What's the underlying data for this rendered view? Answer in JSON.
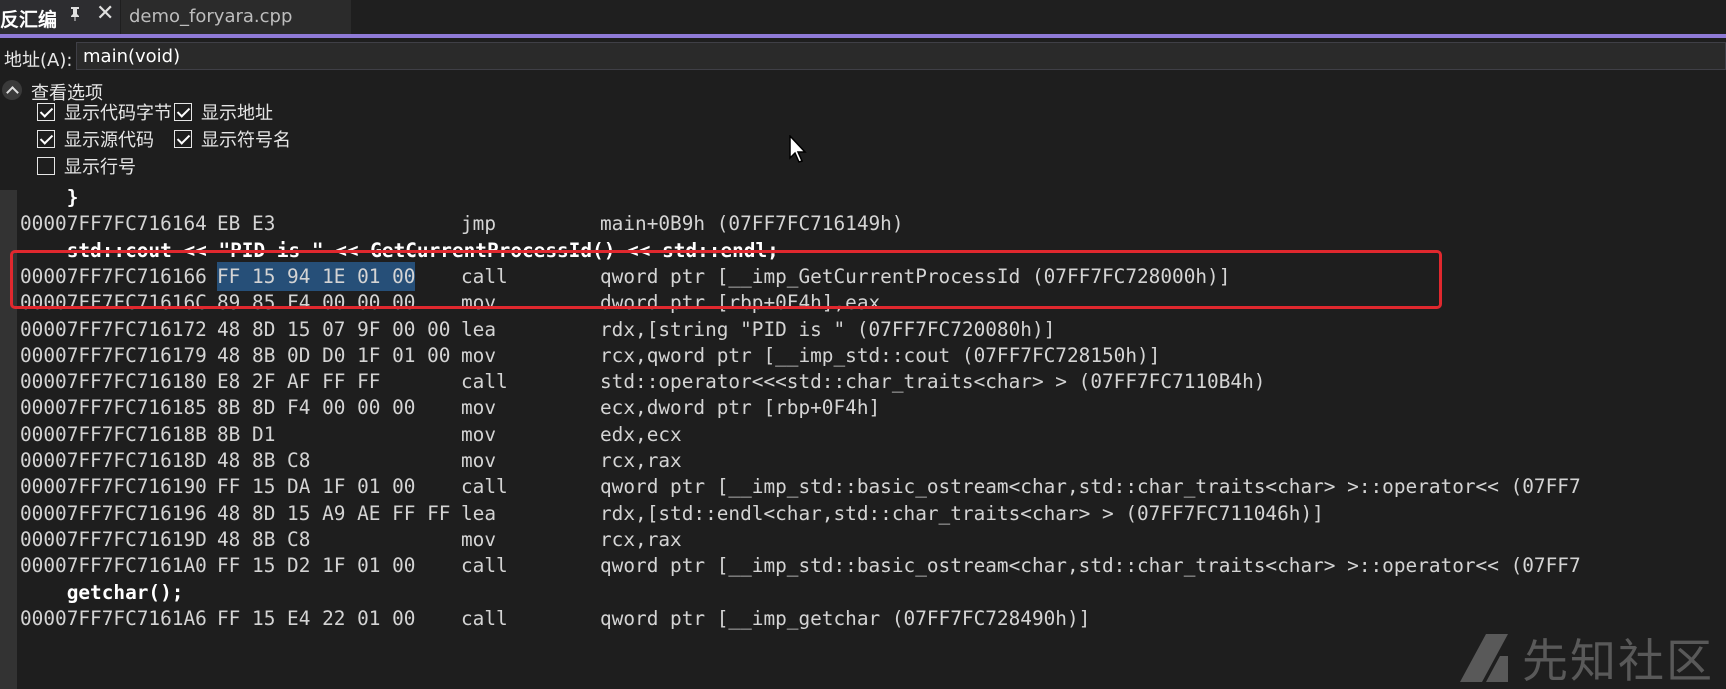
{
  "tabs": {
    "active_title": "反汇编",
    "pin_glyph": "ᵖ",
    "close_glyph": "✕",
    "inactive_title": "demo_foryara.cpp"
  },
  "address": {
    "label": "地址(A):",
    "value": "main(void)"
  },
  "options": {
    "title": "查看选项",
    "checkboxes": [
      {
        "label": "显示代码字节",
        "checked": true
      },
      {
        "label": "显示地址",
        "checked": true
      },
      {
        "label": "显示源代码",
        "checked": true
      },
      {
        "label": "显示符号名",
        "checked": true
      },
      {
        "label": "显示行号",
        "checked": false
      }
    ]
  },
  "code": {
    "lines": [
      {
        "type": "source",
        "text": "    }"
      },
      {
        "type": "asm",
        "addr": "00007FF7FC716164",
        "bytes": "EB E3",
        "op": "jmp",
        "args": "main+0B9h (07FF7FC716149h)"
      },
      {
        "type": "source",
        "text": "    std::cout << \"PID is \" << GetCurrentProcessId() << std::endl;"
      },
      {
        "type": "asm",
        "addr": "00007FF7FC716166",
        "bytes": "FF 15 94 1E 01 00",
        "op": "call",
        "args": "qword ptr [__imp_GetCurrentProcessId (07FF7FC728000h)]",
        "selected_bytes": true
      },
      {
        "type": "asm",
        "addr": "00007FF7FC71616C",
        "bytes": "89 85 F4 00 00 00",
        "op": "mov",
        "args": "dword ptr [rbp+0F4h],eax"
      },
      {
        "type": "asm",
        "addr": "00007FF7FC716172",
        "bytes": "48 8D 15 07 9F 00 00",
        "op": "lea",
        "args": "rdx,[string \"PID is \" (07FF7FC720080h)]"
      },
      {
        "type": "asm",
        "addr": "00007FF7FC716179",
        "bytes": "48 8B 0D D0 1F 01 00",
        "op": "mov",
        "args": "rcx,qword ptr [__imp_std::cout (07FF7FC728150h)]"
      },
      {
        "type": "asm",
        "addr": "00007FF7FC716180",
        "bytes": "E8 2F AF FF FF",
        "op": "call",
        "args": "std::operator<<<std::char_traits<char> > (07FF7FC7110B4h)"
      },
      {
        "type": "asm",
        "addr": "00007FF7FC716185",
        "bytes": "8B 8D F4 00 00 00",
        "op": "mov",
        "args": "ecx,dword ptr [rbp+0F4h]"
      },
      {
        "type": "asm",
        "addr": "00007FF7FC71618B",
        "bytes": "8B D1",
        "op": "mov",
        "args": "edx,ecx"
      },
      {
        "type": "asm",
        "addr": "00007FF7FC71618D",
        "bytes": "48 8B C8",
        "op": "mov",
        "args": "rcx,rax"
      },
      {
        "type": "asm",
        "addr": "00007FF7FC716190",
        "bytes": "FF 15 DA 1F 01 00",
        "op": "call",
        "args": "qword ptr [__imp_std::basic_ostream<char,std::char_traits<char> >::operator<< (07FF7"
      },
      {
        "type": "asm",
        "addr": "00007FF7FC716196",
        "bytes": "48 8D 15 A9 AE FF FF",
        "op": "lea",
        "args": "rdx,[std::endl<char,std::char_traits<char> > (07FF7FC711046h)]"
      },
      {
        "type": "asm",
        "addr": "00007FF7FC71619D",
        "bytes": "48 8B C8",
        "op": "mov",
        "args": "rcx,rax"
      },
      {
        "type": "asm",
        "addr": "00007FF7FC7161A0",
        "bytes": "FF 15 D2 1F 01 00",
        "op": "call",
        "args": "qword ptr [__imp_std::basic_ostream<char,std::char_traits<char> >::operator<< (07FF7"
      },
      {
        "type": "source",
        "text": "    getchar();"
      },
      {
        "type": "asm",
        "addr": "00007FF7FC7161A6",
        "bytes": "FF 15 E4 22 01 00",
        "op": "call",
        "args": "qword ptr [__imp_getchar (07FF7FC728490h)]"
      }
    ]
  },
  "watermark": {
    "text": "先知社区"
  },
  "colors": {
    "accent": "#8f7ad6",
    "highlight_box": "#e0282e",
    "selection": "#264f78"
  }
}
